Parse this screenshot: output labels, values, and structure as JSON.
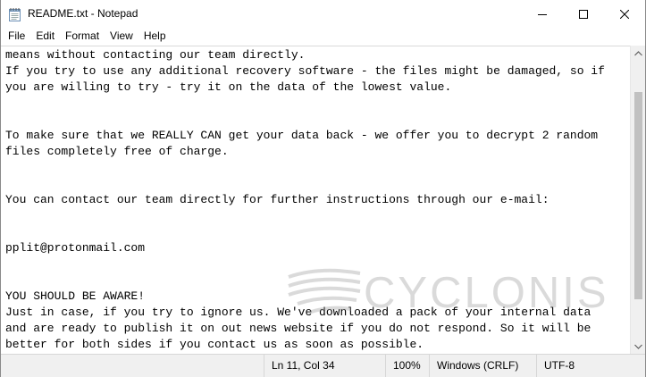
{
  "window": {
    "title": "README.txt - Notepad",
    "icon": "notepad-icon"
  },
  "menu": {
    "items": [
      "File",
      "Edit",
      "Format",
      "View",
      "Help"
    ]
  },
  "editor": {
    "text": "means without contacting our team directly.\nIf you try to use any additional recovery software - the files might be damaged, so if\nyou are willing to try - try it on the data of the lowest value.\n\n\nTo make sure that we REALLY CAN get your data back - we offer you to decrypt 2 random\nfiles completely free of charge.\n\n\nYou can contact our team directly for further instructions through our e-mail:\n\n\npplit@protonmail.com\n\n\nYOU SHOULD BE AWARE!\nJust in case, if you try to ignore us. We've downloaded a pack of your internal data\nand are ready to publish it on out news website if you do not respond. So it will be\nbetter for both sides if you contact us as soon as possible."
  },
  "watermark": {
    "text": "CYCLONIS"
  },
  "statusbar": {
    "position": "Ln 11, Col 34",
    "zoom": "100%",
    "line_endings": "Windows (CRLF)",
    "encoding": "UTF-8"
  },
  "colors": {
    "scroll_thumb": "#c1c1c1",
    "statusbar_bg": "#f0f0f0"
  }
}
